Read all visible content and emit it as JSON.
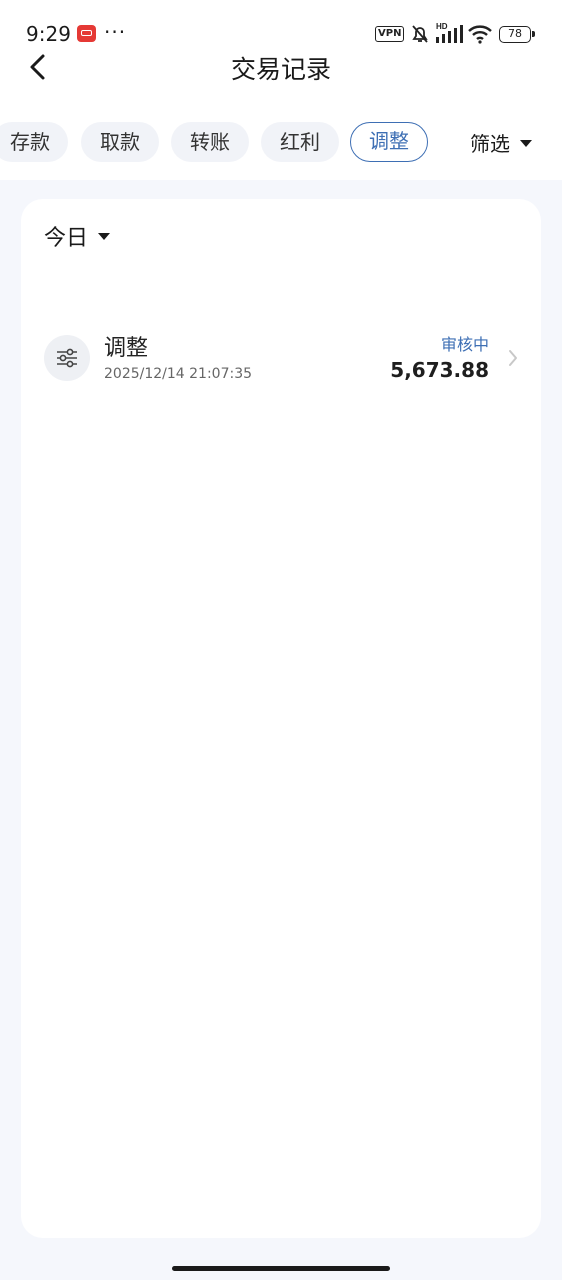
{
  "status_bar": {
    "time": "9:29",
    "dots": "···",
    "vpn": "VPN",
    "battery": "78"
  },
  "header": {
    "title": "交易记录"
  },
  "tabs": [
    {
      "label": "存款",
      "active": false
    },
    {
      "label": "取款",
      "active": false
    },
    {
      "label": "转账",
      "active": false
    },
    {
      "label": "红利",
      "active": false
    },
    {
      "label": "调整",
      "active": true
    }
  ],
  "filter": {
    "label": "筛选"
  },
  "date_filter": {
    "label": "今日"
  },
  "records": [
    {
      "type": "调整",
      "time": "2025/12/14 21:07:35",
      "status": "审核中",
      "amount": "5,673.88",
      "icon": "sliders-icon"
    }
  ],
  "colors": {
    "accent": "#3e6fb4",
    "background": "#f5f7fc"
  }
}
